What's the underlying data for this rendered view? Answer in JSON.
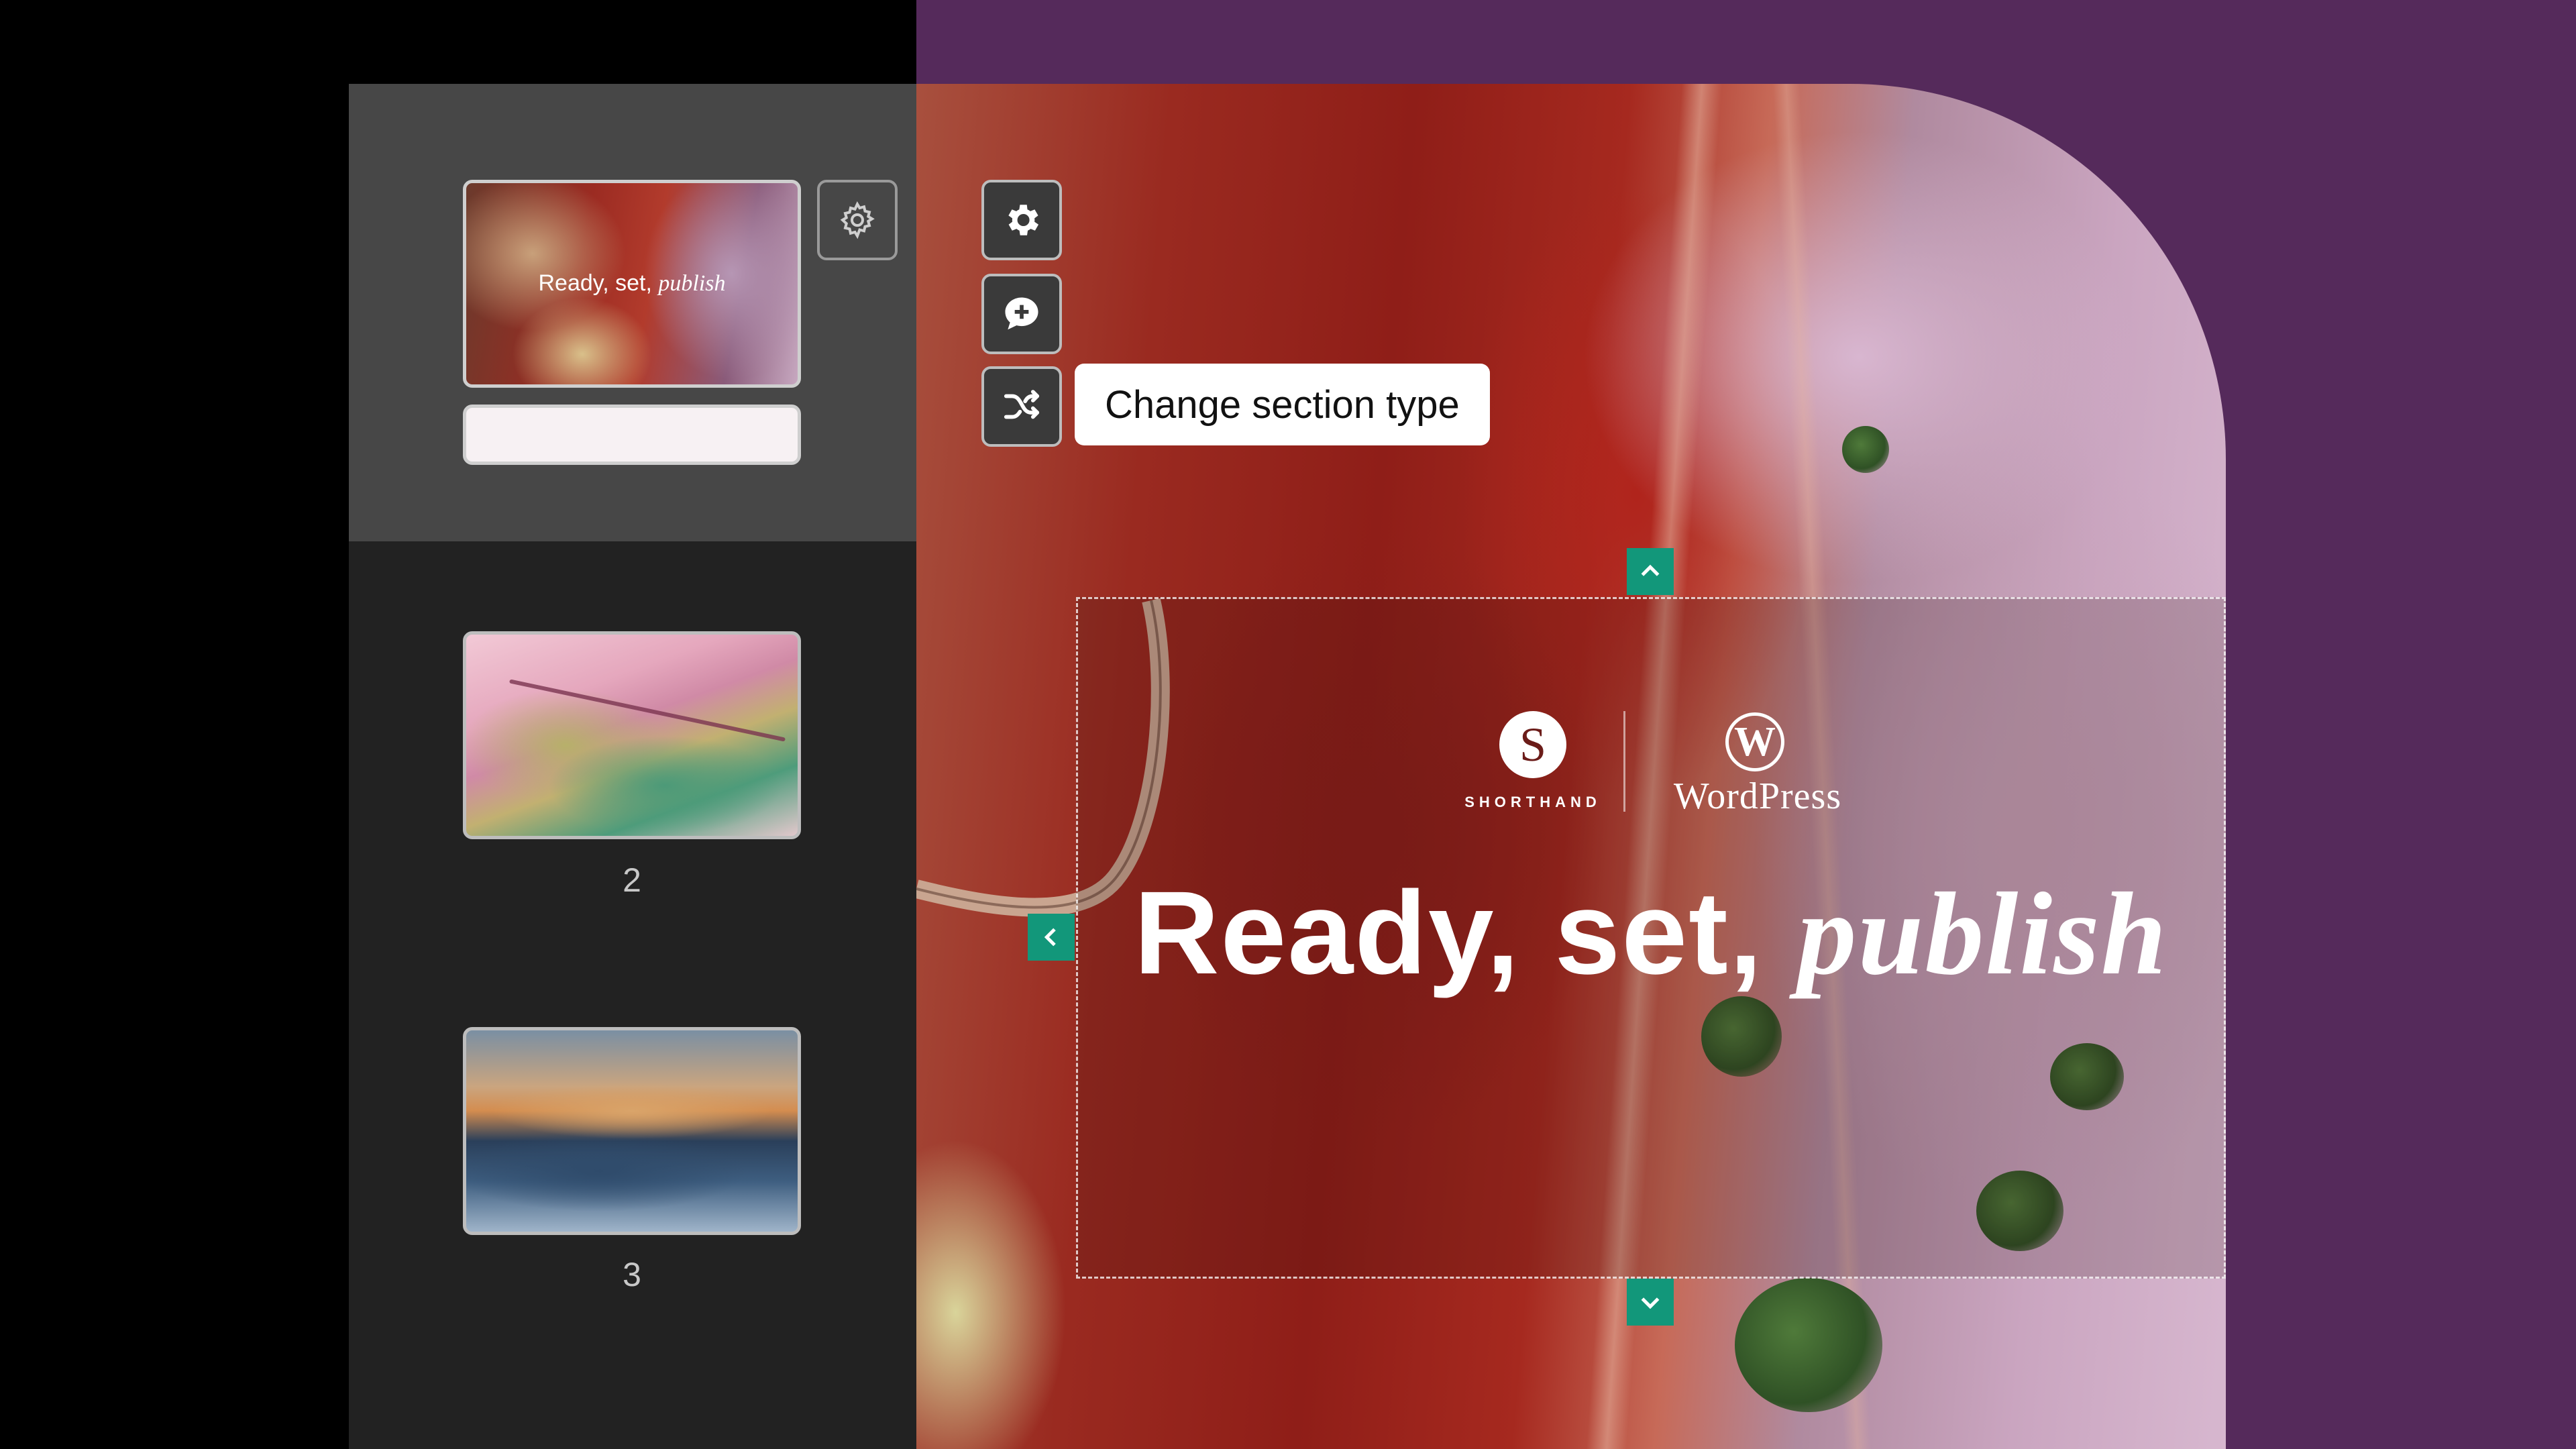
{
  "sidebar": {
    "sections": [
      {
        "thumbnail_title_prefix": "Ready, set, ",
        "thumbnail_title_italic": "publish",
        "number": ""
      },
      {
        "number": "2"
      },
      {
        "number": "3"
      }
    ],
    "settings_icon": "gear-outline-icon"
  },
  "toolbar": {
    "buttons": [
      {
        "icon": "gear-icon"
      },
      {
        "icon": "comment-add-icon"
      },
      {
        "icon": "shuffle-icon"
      }
    ],
    "tooltip": "Change section type"
  },
  "section": {
    "logo_left_letter": "S",
    "logo_left_word": "SHORTHAND",
    "logo_right_letter": "W",
    "logo_right_word": "WordPress",
    "headline_prefix": "Ready, set, ",
    "headline_italic": "publish"
  },
  "colors": {
    "accent": "#12977a",
    "brand_purple": "#552a5b",
    "panel": "#222222",
    "panel_active": "#474747"
  }
}
